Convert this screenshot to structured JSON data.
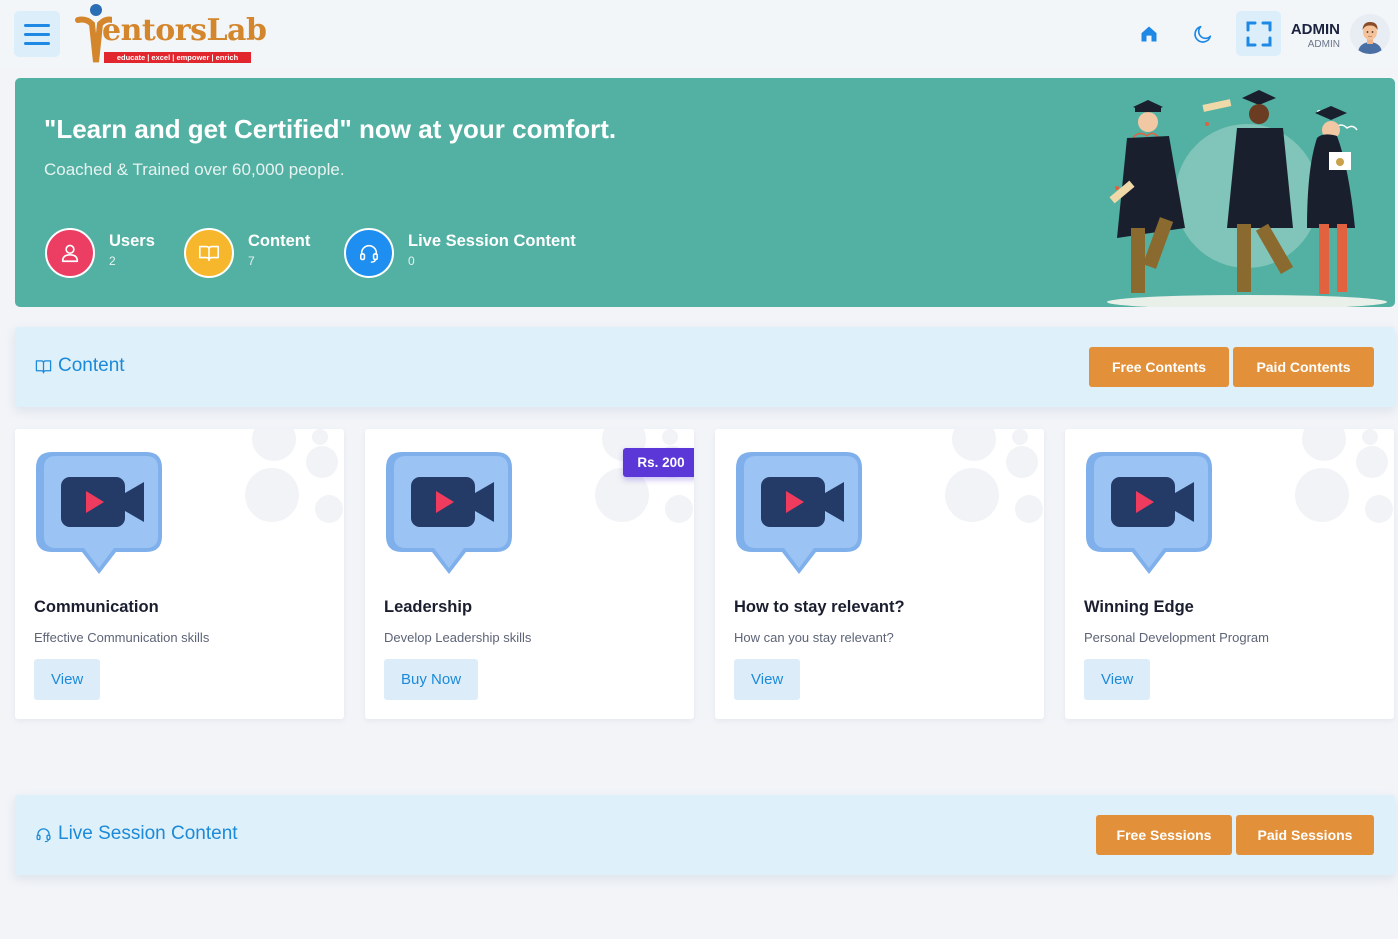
{
  "header": {
    "logo": {
      "wordmark": "MentorsLab",
      "word_visible": "entorsLab",
      "tagline": "educate | excel | empower | enrich"
    },
    "icons": [
      "menu-icon",
      "home-icon",
      "moon-icon",
      "fullscreen-icon"
    ],
    "user": {
      "name": "ADMIN",
      "role": "ADMIN"
    }
  },
  "hero": {
    "title": "\"Learn and get Certified\" now at your comfort.",
    "subtitle": "Coached & Trained over 60,000 people.",
    "stats": [
      {
        "label": "Users",
        "value": "2",
        "icon": "user-icon",
        "color": "#ec3d63"
      },
      {
        "label": "Content",
        "value": "7",
        "icon": "book-icon",
        "color": "#f6b72c"
      },
      {
        "label": "Live Session Content",
        "value": "0",
        "icon": "headset-icon",
        "color": "#1e8ef0"
      }
    ]
  },
  "content_section": {
    "title": "Content",
    "buttons": [
      "Free Contents",
      "Paid Contents"
    ]
  },
  "cards": [
    {
      "title": "Communication",
      "description": "Effective Communication skills",
      "action": "View",
      "price": null
    },
    {
      "title": "Leadership",
      "description": "Develop Leadership skills",
      "action": "Buy Now",
      "price": "Rs. 200"
    },
    {
      "title": "How to stay relevant?",
      "description": "How can you stay relevant?",
      "action": "View",
      "price": null
    },
    {
      "title": "Winning Edge",
      "description": "Personal Development Program",
      "action": "View",
      "price": null
    }
  ],
  "live_section": {
    "title": "Live Session Content",
    "buttons": [
      "Free Sessions",
      "Paid Sessions"
    ]
  },
  "colors": {
    "accent": "#1c8ad8",
    "hero_bg": "#53b1a3",
    "orange": "#e2913a",
    "badge": "#5b37d8"
  }
}
